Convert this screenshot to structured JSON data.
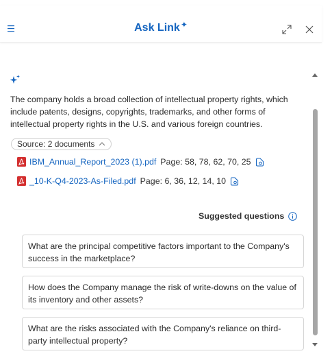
{
  "header": {
    "title": "Ask Link",
    "title_spark": "✦",
    "menu_icon": "hamburger-icon",
    "expand_icon": "expand-icon",
    "close_icon": "close-icon"
  },
  "answer": {
    "icon": "sparkle-icon",
    "text": "The company holds a broad collection of intellectual property rights, which include patents, designs, copyrights, trademarks, and other forms of intellectual property rights in the U.S. and various foreign countries."
  },
  "sources": {
    "label": "Source: 2 documents",
    "documents": [
      {
        "name": "IBM_Annual_Report_2023 (1).pdf",
        "pages": "Page: 58, 78, 62, 70, 25"
      },
      {
        "name": "_10-K-Q4-2023-As-Filed.pdf",
        "pages": "Page: 6, 36, 12, 14, 10"
      }
    ]
  },
  "suggestions": {
    "heading": "Suggested questions",
    "items": [
      "What are the principal competitive factors important to the Company's success in the marketplace?",
      "How does the Company manage the risk of write-downs on the value of its inventory and other assets?",
      "What are the risks associated with the Company's reliance on third-party intellectual property?"
    ]
  },
  "colors": {
    "accent": "#1565c0",
    "pdf_red": "#d32f2f",
    "scroll_thumb": "#a6a6a6"
  }
}
